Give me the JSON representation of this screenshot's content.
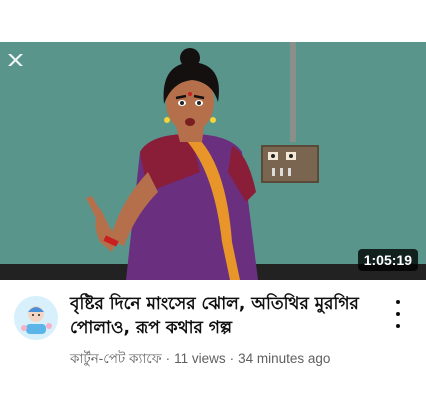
{
  "video": {
    "duration": "1:05:19",
    "title": "বৃষ্টির দিনে মাংসের ঝোল, অতিথির মুরগির পোলাও, রূপ কথার গল্প",
    "channel": "কার্টুন-পেট ক্যাফে",
    "views": "11 views",
    "age": "34 minutes ago",
    "separator": "·"
  },
  "icons": {
    "menu": "more-vert-icon",
    "channel_logo": "app-logo-icon"
  }
}
